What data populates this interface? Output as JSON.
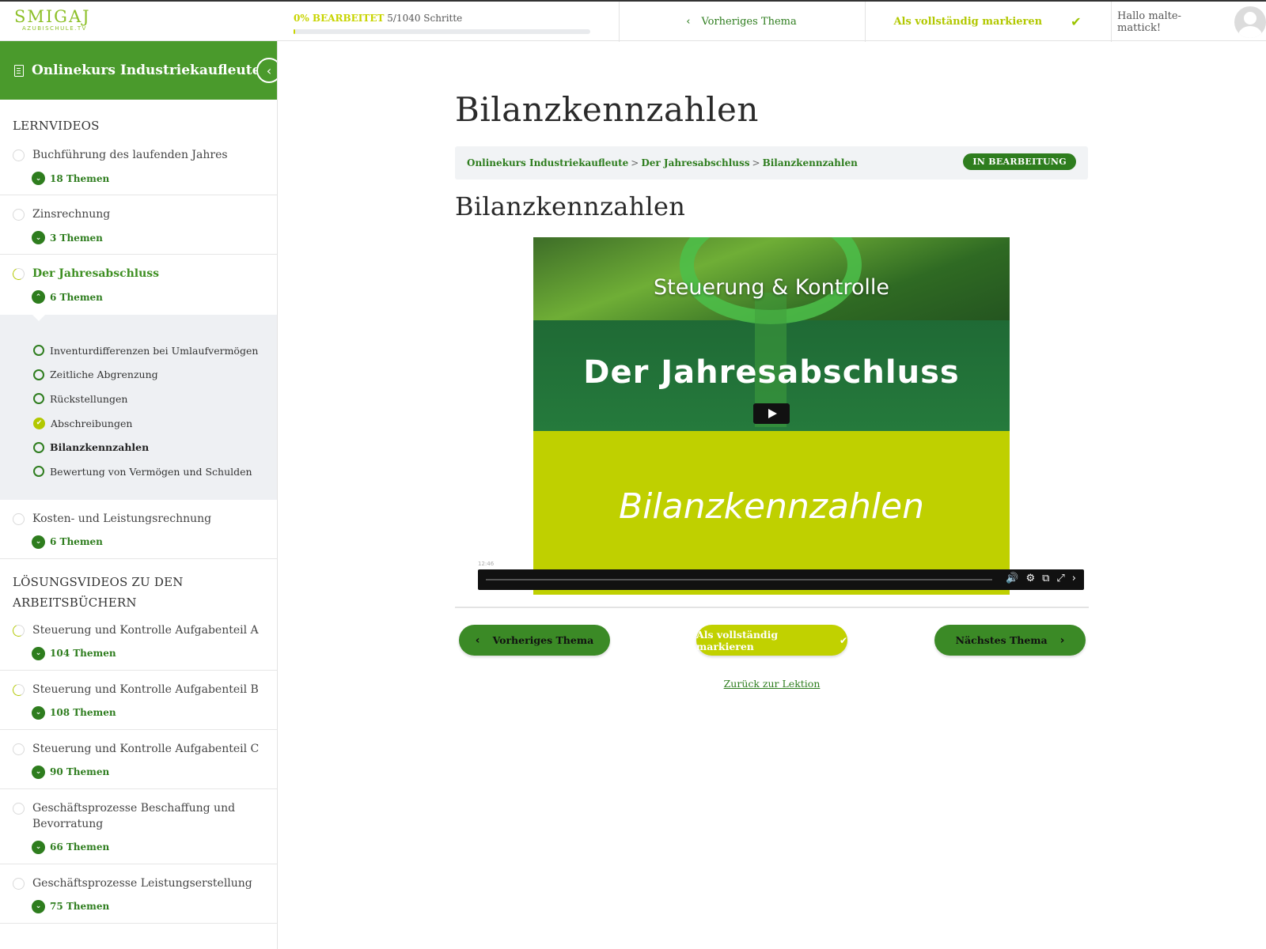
{
  "header": {
    "logo_main": "SMIGAJ",
    "logo_sub": "AZUBISCHULE.TV",
    "progress_percent_label": "0% BEARBEITET",
    "progress_steps": "5/1040 Schritte",
    "progress_fraction": 0.005,
    "prev_topic": "Vorheriges Thema",
    "mark_complete": "Als vollständig markieren",
    "greeting": "Hallo malte-mattick!"
  },
  "sidebar": {
    "course_title": "Onlinekurs Industriekaufleute",
    "section1_title": "LERNVIDEOS",
    "section1_lessons": [
      {
        "title": "Buchführung des laufenden Jahres",
        "topics": "18 Themen"
      },
      {
        "title": "Zinsrechnung",
        "topics": "3 Themen"
      },
      {
        "title": "Der Jahresabschluss",
        "topics": "6 Themen"
      },
      {
        "title": "Kosten- und Leistungsrechnung",
        "topics": "6 Themen"
      }
    ],
    "subitems": [
      "Inventurdifferenzen bei Umlaufvermögen",
      "Zeitliche Abgrenzung",
      "Rückstellungen",
      "Abschreibungen",
      "Bilanzkennzahlen",
      "Bewertung von Vermögen und Schulden"
    ],
    "section2_title": "LÖSUNGSVIDEOS ZU DEN ARBEITSBÜCHERN",
    "section2_lessons": [
      {
        "title": "Steuerung und Kontrolle Aufgabenteil A",
        "topics": "104 Themen"
      },
      {
        "title": "Steuerung und Kontrolle Aufgabenteil B",
        "topics": "108 Themen"
      },
      {
        "title": "Steuerung und Kontrolle Aufgabenteil C",
        "topics": "90 Themen"
      },
      {
        "title": "Geschäftsprozesse Beschaffung und Bevorratung",
        "topics": "66 Themen"
      },
      {
        "title": "Geschäftsprozesse Leistungserstellung",
        "topics": "75 Themen"
      }
    ]
  },
  "main": {
    "title": "Bilanzkennzahlen",
    "breadcrumb": [
      "Onlinekurs Industriekaufleute",
      "Der Jahresabschluss",
      "Bilanzkennzahlen"
    ],
    "breadcrumb_sep": ">",
    "status_badge": "IN BEARBEITUNG",
    "subtitle": "Bilanzkennzahlen",
    "video": {
      "line1": "Steuerung & Kontrolle",
      "line2": "Der Jahresabschluss",
      "line3": "Bilanzkennzahlen",
      "time": "12:46"
    },
    "prev_button": "Vorheriges Thema",
    "mark_button": "Als vollständig markieren",
    "next_button": "Nächstes Thema",
    "back_link": "Zurück zur Lektion"
  },
  "colors": {
    "brand_green": "#2e7d1e",
    "header_green": "#4a9a2c",
    "accent_lime": "#c1d100"
  }
}
